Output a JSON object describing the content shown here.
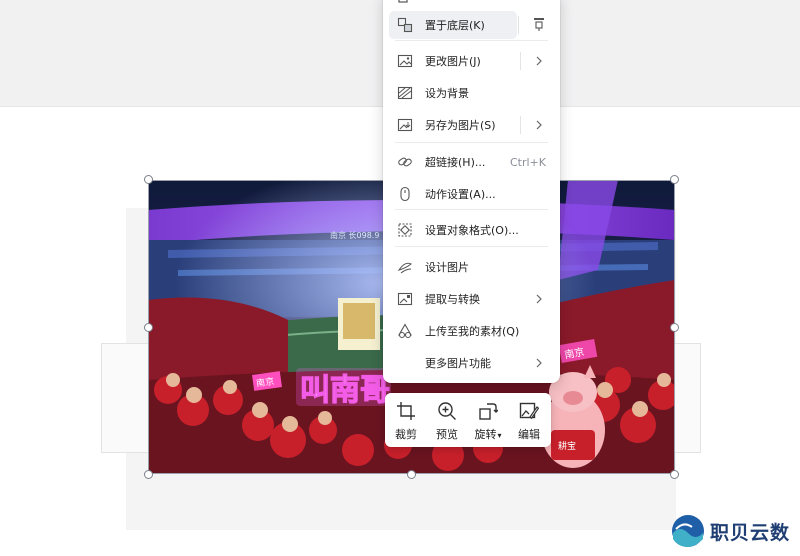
{
  "context_menu": {
    "items": [
      {
        "label": "置于底层(K)",
        "icon": "send-to-back-icon"
      },
      {
        "label": "更改图片(J)",
        "icon": "change-picture-icon",
        "submenu": true
      },
      {
        "label": "设为背景",
        "icon": "set-background-icon"
      },
      {
        "label": "另存为图片(S)",
        "icon": "save-as-picture-icon",
        "submenu": true
      },
      {
        "label": "超链接(H)...",
        "icon": "hyperlink-icon",
        "shortcut": "Ctrl+K"
      },
      {
        "label": "动作设置(A)...",
        "icon": "action-settings-icon"
      },
      {
        "label": "设置对象格式(O)...",
        "icon": "format-object-icon"
      },
      {
        "label": "设计图片",
        "icon": "design-picture-icon"
      },
      {
        "label": "提取与转换",
        "icon": "extract-convert-icon",
        "submenu": true
      },
      {
        "label": "上传至我的素材(Q)",
        "icon": "upload-material-icon"
      },
      {
        "label": "更多图片功能",
        "icon": "",
        "submenu": true
      }
    ]
  },
  "picture": {
    "neon_sign_text": "叫南哥",
    "pink_sign_text": "南京",
    "stand_banner_text": "南京 长098.9",
    "right_sign_text": "南京",
    "mascot_text": "耕宝"
  },
  "toolbar": {
    "crop_label": "裁剪",
    "preview_label": "预览",
    "rotate_label": "旋转",
    "edit_label": "编辑"
  },
  "watermark": {
    "text": "职贝云数"
  },
  "colors": {
    "accent": "#2a6fdb",
    "menu_hover": "#eef0f4",
    "crowd_red": "#c8202b",
    "neon_pink": "#f25ce6"
  }
}
